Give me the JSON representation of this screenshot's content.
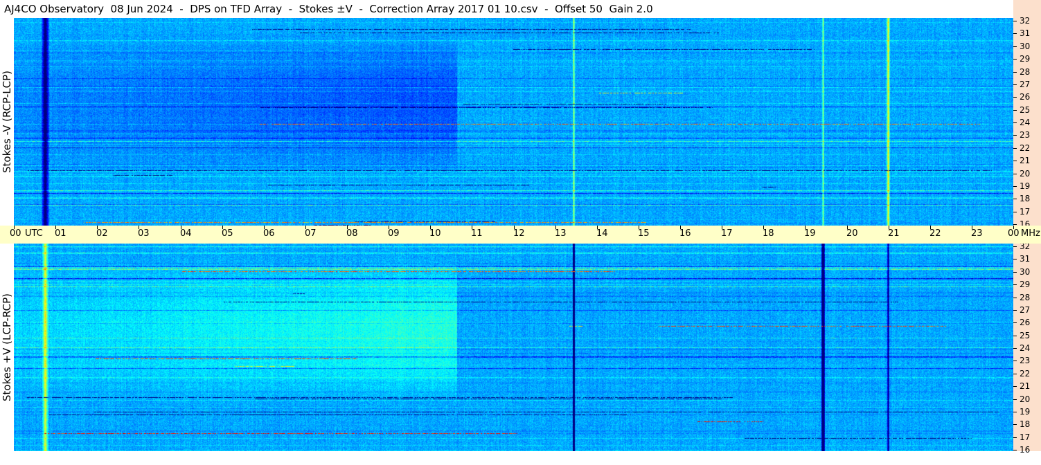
{
  "title": "AJ4CO Observatory  08 Jun 2024  -  DPS on TFD Array  -  Stokes ±V  -  Correction Array 2017 01 10.csv  -  Offset 50  Gain 2.0",
  "chart_data": [
    {
      "type": "heatmap",
      "panel": "top",
      "ylabel": "Stokes -V (RCP-LCP)",
      "yunit": "MHz",
      "ylim": [
        16,
        32
      ],
      "yticks": [
        "16",
        "17",
        "18",
        "19",
        "20",
        "21",
        "22",
        "23",
        "24",
        "25",
        "26",
        "27",
        "28",
        "29",
        "30",
        "31",
        "32"
      ],
      "xlim": [
        0,
        24
      ],
      "dominant_color": "#1a64e6"
    },
    {
      "type": "heatmap",
      "panel": "bottom",
      "ylabel": "Stokes +V (LCP-RCP)",
      "yunit": "MHz",
      "ylim": [
        16,
        32
      ],
      "yticks": [
        "16",
        "17",
        "18",
        "19",
        "20",
        "21",
        "22",
        "23",
        "24",
        "25",
        "26",
        "27",
        "28",
        "29",
        "30",
        "31",
        "32"
      ],
      "xlim": [
        0,
        24
      ],
      "dominant_color": "#1c72ec"
    }
  ],
  "time_axis": {
    "unit_label": "UTC",
    "freq_unit_label": "MHz",
    "ticks": [
      "00",
      "01",
      "02",
      "03",
      "04",
      "05",
      "06",
      "07",
      "08",
      "09",
      "10",
      "11",
      "12",
      "13",
      "14",
      "15",
      "16",
      "17",
      "18",
      "19",
      "20",
      "21",
      "22",
      "23",
      "00"
    ]
  },
  "colors": {
    "time_axis_bg": "#ffffc8",
    "freq_axis_bg": "#fce0cc"
  }
}
